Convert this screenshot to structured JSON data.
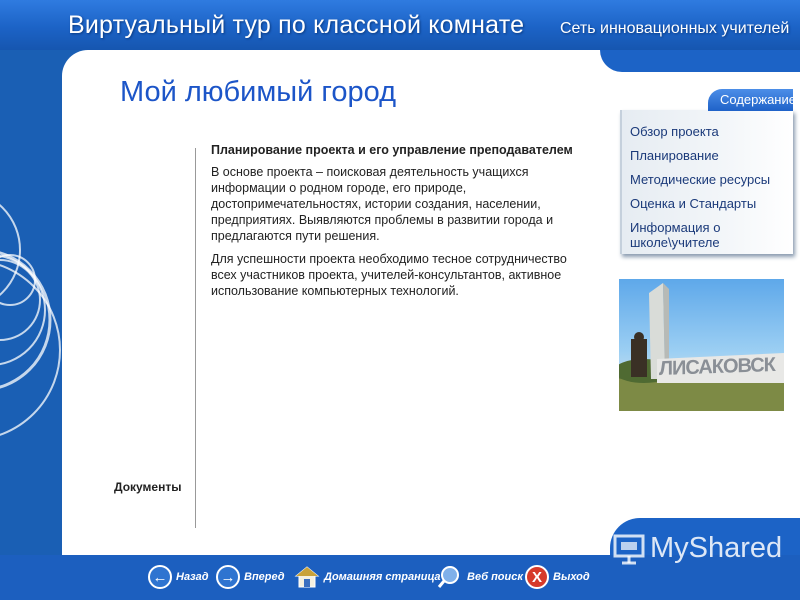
{
  "header": {
    "title": "Виртуальный тур по классной комнате",
    "network": "Сеть инновационных учителей"
  },
  "page": {
    "title": "Мой любимый город",
    "documents_label": "Документы"
  },
  "article": {
    "heading": "Планирование проекта и его управление преподавателем",
    "paragraph1": "В основе проекта – поисковая деятельность учащихся информации о родном городе, его природе, достопримечательностях, истории создания, населении, предприятиях. Выявляются проблемы в развитии города и предлагаются пути решения.",
    "paragraph2": "Для успешности проекта необходимо тесное сотрудничество всех участников проекта, учителей-консультантов, активное использование компьютерных технологий."
  },
  "menu": {
    "tab_label": "Содержание",
    "items": [
      "Обзор проекта",
      "Планирование",
      "Методические ресурсы",
      "Оценка и Стандарты",
      "Информация о школе\\учителе"
    ]
  },
  "photo": {
    "sign_text": "ЛИСАКОВСК",
    "icon": "city-monument-photo"
  },
  "nav": {
    "back": "Назад",
    "forward": "Вперед",
    "home": "Домашняя страница",
    "search": "Веб поиск",
    "exit": "Выход",
    "exit_glyph": "X"
  },
  "watermark": {
    "text": "MyShared"
  },
  "colors": {
    "brand_blue": "#1c63c6",
    "title_blue": "#1c55c8",
    "menu_text": "#1b3a7a"
  }
}
